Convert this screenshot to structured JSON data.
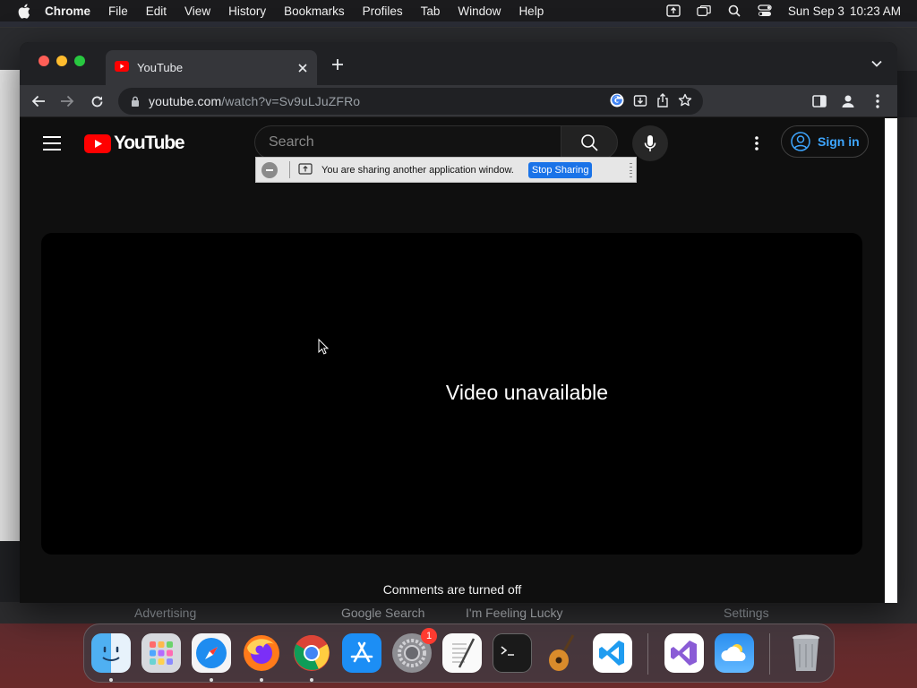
{
  "menubar": {
    "app_name": "Chrome",
    "items": [
      "File",
      "Edit",
      "View",
      "History",
      "Bookmarks",
      "Profiles",
      "Tab",
      "Window",
      "Help"
    ],
    "date": "Sun Sep 3",
    "time": "10:23 AM"
  },
  "background_window": {
    "button_left": "Google Search",
    "button_right": "I'm Feeling Lucky",
    "link_left": "Advertising",
    "link_right": "Settings"
  },
  "browser": {
    "tab_title": "YouTube",
    "url_host": "youtube.com",
    "url_path": "/watch?v=Sv9uLJuZFRo"
  },
  "youtube": {
    "logo_text": "YouTube",
    "search_placeholder": "Search",
    "sign_in_label": "Sign in",
    "player_message": "Video unavailable",
    "comments_message": "Comments are turned off"
  },
  "sharing_bar": {
    "message": "You are sharing another application window.",
    "stop_label": "Stop Sharing"
  },
  "dock": {
    "apps": [
      "Finder",
      "Launchpad",
      "Safari",
      "Firefox",
      "Google Chrome",
      "App Store",
      "System Settings",
      "TextEdit",
      "Terminal",
      "GarageBand",
      "Visual Studio Code",
      "Visual Studio",
      "Weather",
      "Trash"
    ],
    "settings_badge": "1"
  },
  "colors": {
    "youtube_red": "#ff0000",
    "link_blue": "#3ea6ff",
    "stop_sharing_blue": "#1a73e8"
  }
}
